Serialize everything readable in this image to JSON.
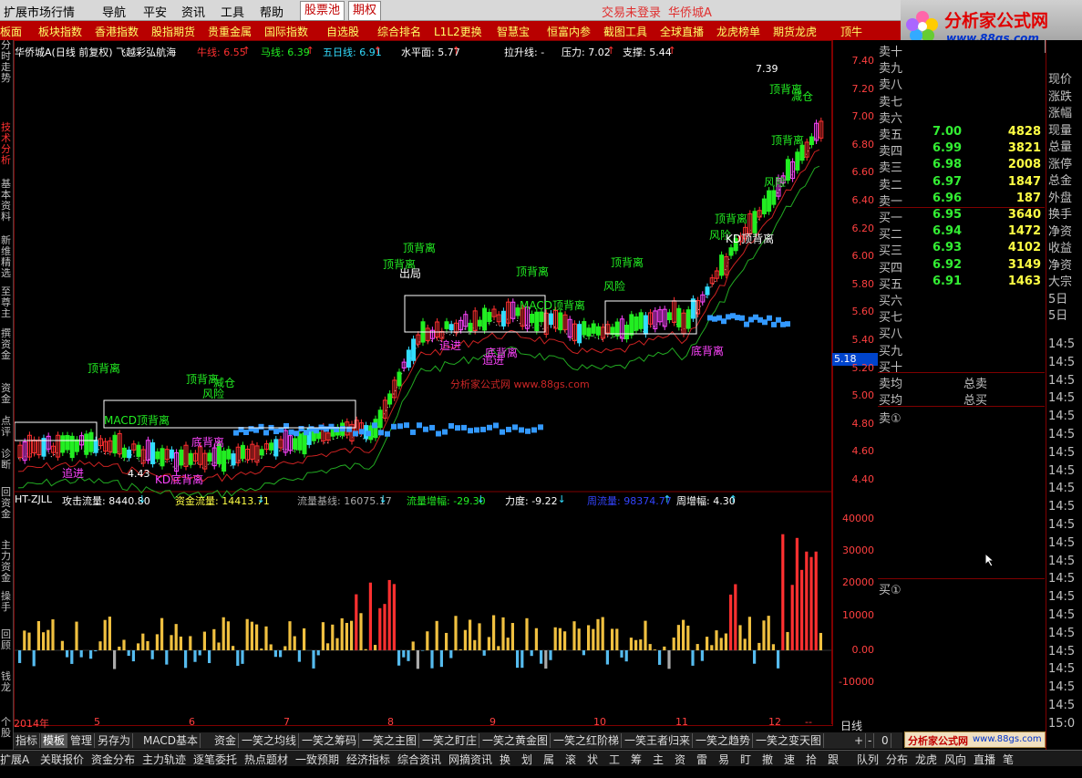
{
  "menubar": {
    "items": [
      "扩展市场行情",
      "导航",
      "平安",
      "资讯",
      "工具",
      "帮助"
    ],
    "tabs": [
      "股票池",
      "期权"
    ],
    "login_status": "交易未登录",
    "stock_name": "华侨城A"
  },
  "subbar": {
    "items": [
      "板面",
      "板块指数",
      "香港指数",
      "股指期货",
      "贵重金属",
      "国际指数",
      "自选股",
      "综合排名",
      "L1L2更换",
      "智慧宝",
      "恒富内参",
      "截图工具",
      "全球直播",
      "龙虎榜单",
      "期货龙虎",
      "顶牛"
    ]
  },
  "logo": {
    "name": "分析家公式网",
    "url_text": "www.88gs.com"
  },
  "left_tabs": [
    {
      "label": "分时走势",
      "active": false
    },
    {
      "label": "技术分析",
      "active": true
    },
    {
      "label": "基本资料",
      "active": false
    },
    {
      "label": "新维精选",
      "active": false
    },
    {
      "label": "至尊主",
      "active": false
    },
    {
      "label": "撰资金",
      "active": false
    },
    {
      "label": "资金",
      "active": false
    },
    {
      "label": "点评",
      "active": false
    },
    {
      "label": "诊断",
      "active": false
    },
    {
      "label": "回资金",
      "active": false
    },
    {
      "label": "主力资金",
      "active": false
    },
    {
      "label": "操手",
      "active": false
    },
    {
      "label": "回顾",
      "active": false
    },
    {
      "label": "钱龙",
      "active": false
    },
    {
      "label": "个股",
      "active": false
    }
  ],
  "main_chart": {
    "title": "华侨城A(日线 前复权) 飞越彩弘航海",
    "indicators": [
      {
        "label": "牛线: 6.55",
        "arrow": "↑",
        "color": "#ff3030"
      },
      {
        "label": "马线: 6.39",
        "arrow": "↑",
        "color": "#22ee22"
      },
      {
        "label": "五日线: 6.91",
        "arrow": "↑",
        "color": "#33ddff"
      },
      {
        "label": "水平面: 5.77",
        "arrow": "↑",
        "color": "#ffffff"
      },
      {
        "label": "拉升线: -",
        "arrow": "",
        "color": "#ffffff"
      },
      {
        "label": "压力: 7.02",
        "arrow": "↑",
        "color": "#ffffff"
      },
      {
        "label": "支撑: 5.44",
        "arrow": "↑",
        "color": "#ffffff"
      }
    ],
    "high_marker": "7.39",
    "low_marker": "4.43",
    "current_price": "5.18",
    "watermark": "分析家公式网 www.88gs.com",
    "y_ticks": [
      "7.40",
      "7.20",
      "7.00",
      "6.80",
      "6.60",
      "6.40",
      "6.20",
      "6.00",
      "5.80",
      "5.60",
      "5.40",
      "5.20",
      "5.00",
      "4.80",
      "4.60",
      "4.40"
    ],
    "annotations": [
      {
        "text": "顶背离",
        "cls": "g"
      },
      {
        "text": "顶背离",
        "cls": "g"
      },
      {
        "text": "顶背离",
        "cls": "g"
      },
      {
        "text": "顶背离",
        "cls": "g"
      },
      {
        "text": "顶背离",
        "cls": "g"
      },
      {
        "text": "顶背离",
        "cls": "g"
      },
      {
        "text": "顶背离",
        "cls": "g"
      },
      {
        "text": "顶背离",
        "cls": "g"
      },
      {
        "text": "顶背离",
        "cls": "g"
      },
      {
        "text": "MACD顶背离",
        "cls": "g"
      },
      {
        "text": "MACD顶背离",
        "cls": "g"
      },
      {
        "text": "风险",
        "cls": "g"
      },
      {
        "text": "风险",
        "cls": "g"
      },
      {
        "text": "风险",
        "cls": "g"
      },
      {
        "text": "风险",
        "cls": "g"
      },
      {
        "text": "减仓",
        "cls": "g"
      },
      {
        "text": "减仓",
        "cls": "g"
      },
      {
        "text": "出局",
        "cls": "w"
      },
      {
        "text": "KD顶背离",
        "cls": "w"
      },
      {
        "text": "追进",
        "cls": "m"
      },
      {
        "text": "追进",
        "cls": "m"
      },
      {
        "text": "追进",
        "cls": "m"
      },
      {
        "text": "底背离",
        "cls": "m"
      },
      {
        "text": "底背离",
        "cls": "m"
      },
      {
        "text": "底背离",
        "cls": "m"
      },
      {
        "text": "KD底背离",
        "cls": "m"
      }
    ]
  },
  "sub_chart": {
    "indicator_name": "HT-ZJLL",
    "legend": [
      {
        "label": "攻击流量: 8440.80",
        "arrow": "↓",
        "color": "#ffffff"
      },
      {
        "label": "资金流量: 14413.71",
        "arrow": "↓",
        "color": "#ffff44"
      },
      {
        "label": "流量基线: 16075.17",
        "arrow": "↓",
        "color": "#aaaaaa"
      },
      {
        "label": "流量增幅: -29.30",
        "arrow": "↓",
        "color": "#22ee22"
      },
      {
        "label": "力度: -9.22",
        "arrow": "↓",
        "color": "#ffffff"
      },
      {
        "label": "周流量: 98374.77",
        "arrow": "↑",
        "color": "#3344ff"
      },
      {
        "label": "周增幅: 4.30",
        "arrow": "↑",
        "color": "#ffffff"
      }
    ],
    "y_ticks": [
      "40000",
      "30000",
      "20000",
      "10000",
      "0.00",
      "-10000"
    ]
  },
  "x_axis": {
    "labels": [
      "2014年",
      "5",
      "6",
      "7",
      "8",
      "9",
      "10",
      "11",
      "12",
      "--"
    ],
    "period": "日线"
  },
  "order_book": {
    "sell_extra": [
      "卖十",
      "卖九",
      "卖八",
      "卖七",
      "卖六"
    ],
    "sells": [
      {
        "label": "卖五",
        "price": "7.00",
        "vol": "4828"
      },
      {
        "label": "卖四",
        "price": "6.99",
        "vol": "3821"
      },
      {
        "label": "卖三",
        "price": "6.98",
        "vol": "2008"
      },
      {
        "label": "卖二",
        "price": "6.97",
        "vol": "1847"
      },
      {
        "label": "卖一",
        "price": "6.96",
        "vol": "187"
      }
    ],
    "buys": [
      {
        "label": "买一",
        "price": "6.95",
        "vol": "3640"
      },
      {
        "label": "买二",
        "price": "6.94",
        "vol": "1472"
      },
      {
        "label": "买三",
        "price": "6.93",
        "vol": "4102"
      },
      {
        "label": "买四",
        "price": "6.92",
        "vol": "3149"
      },
      {
        "label": "买五",
        "price": "6.91",
        "vol": "1463"
      }
    ],
    "buy_extra": [
      "买六",
      "买七",
      "买八",
      "买九",
      "买十"
    ],
    "avg_sell": "卖均",
    "avg_buy": "买均",
    "total_sell": "总卖",
    "total_buy": "总买",
    "sell_queue": "卖①",
    "buy_queue": "买①"
  },
  "far_right": {
    "items": [
      "现价",
      "涨跌",
      "涨幅",
      "现量",
      "总量",
      "涨停",
      "总金",
      "外盘",
      "换手",
      "净资",
      "收益",
      "净资",
      "大宗",
      "5日",
      "5日"
    ],
    "times": [
      "14:5",
      "14:5",
      "14:5",
      "14:5",
      "14:5",
      "14:5",
      "14:5",
      "14:5",
      "14:5",
      "14:5",
      "14:5",
      "14:5",
      "14:5",
      "14:5",
      "14:5",
      "14:5",
      "14:5",
      "14:5",
      "14:5",
      "14:5",
      "14:5",
      "15:0"
    ]
  },
  "tab_bar": {
    "tabs": [
      "指标",
      "模板",
      "管理",
      "另存为",
      "MACD基本",
      "资金",
      "一笑之均线",
      "一笑之筹码",
      "一笑之主图",
      "一笑之盯庄",
      "一笑之黄金图",
      "一笑之红阶梯",
      "一笑王者归来",
      "一笑之趋势",
      "一笑之变天图"
    ],
    "active": "模板",
    "controls": [
      "+",
      "-",
      "0"
    ]
  },
  "status_bar": {
    "items": [
      "扩展A",
      "关联报价",
      "资金分布",
      "主力轨迹",
      "逐笔委托",
      "热点题材",
      "一致预期",
      "经济指标",
      "综合资讯",
      "网摘资讯",
      "换",
      "划",
      "属",
      "滚",
      "状",
      "工",
      "筹",
      "主",
      "资",
      "雷",
      "易",
      "盯",
      "撤",
      "速",
      "拾",
      "跟",
      "队列",
      "分布",
      "龙虎",
      "风向",
      "直播",
      "笔"
    ]
  },
  "watermark_bottom": {
    "name": "分析家公式网",
    "url": "www.88gs.com"
  },
  "colors": {
    "up": "#ff3030",
    "down": "#22ee22",
    "accent_blue": "#33aaff",
    "volume_yellow": "#f0c040"
  }
}
